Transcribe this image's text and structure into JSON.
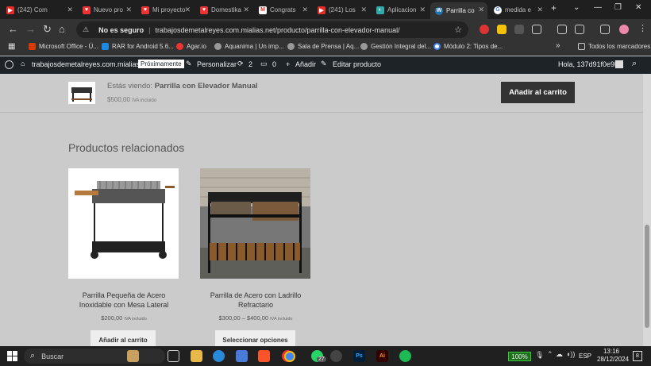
{
  "tabs": [
    {
      "label": "(242) Com",
      "color": "#e52d27",
      "glyph": "▶"
    },
    {
      "label": "Nuevo pro",
      "color": "#e33",
      "glyph": "♥"
    },
    {
      "label": "Mi proyecto",
      "color": "#e33",
      "glyph": "♥"
    },
    {
      "label": "Domestika",
      "color": "#e33",
      "glyph": "♥"
    },
    {
      "label": "Congrats",
      "color": "#fff",
      "glyph": "M"
    },
    {
      "label": "(241) Los",
      "color": "#e52d27",
      "glyph": "▶"
    },
    {
      "label": "Aplicacion",
      "color": "#3aa",
      "glyph": "◐"
    },
    {
      "label": "Parrilla co",
      "color": "#2271b1",
      "glyph": "W"
    },
    {
      "label": "medida e",
      "color": "#fff",
      "glyph": "G"
    }
  ],
  "new_tab": "+",
  "window": {
    "minimize": "—",
    "restore": "❐",
    "close": "✕",
    "chevron": "⌄"
  },
  "nav": {
    "back": "←",
    "forward": "→",
    "reload": "↻",
    "home": "⌂"
  },
  "address": {
    "security": "No es seguro",
    "url": "trabajosdemetalreyes.com.mialias.net/producto/parrilla-con-elevador-manual/",
    "star": "☆"
  },
  "bookmarks": [
    {
      "label": "Microsoft Office - Ú...",
      "color": "#d83b01"
    },
    {
      "label": "RAR for Android 5.6...",
      "color": "#1e88e5"
    },
    {
      "label": "Agar.io",
      "color": "#e33"
    },
    {
      "label": "Aquanima | Un imp...",
      "color": "#999"
    },
    {
      "label": "Sala de Prensa | Aq...",
      "color": "#999"
    },
    {
      "label": "Gestión Integral del...",
      "color": "#999"
    },
    {
      "label": "Módulo 2: Tipos de...",
      "color": "#4285f4"
    }
  ],
  "bookmarks_more": "»",
  "bookmarks_all": "Todos los marcadores",
  "wpbar": {
    "site": "trabajosdemetalreyes.com.mialias.net",
    "badge": "Próximamente",
    "customize": "Personalizar",
    "updates": "2",
    "comments": "0",
    "new": "Añadir",
    "edit": "Editar producto",
    "greeting": "Hola, 137d91f0e9b5"
  },
  "sticky": {
    "viewing_prefix": "Estás viendo:",
    "product": "Parrilla con Elevador Manual",
    "price": "$500,00",
    "tax": "IVA incluido",
    "cta": "Añadir al carrito"
  },
  "related": {
    "heading": "Productos relacionados",
    "products": [
      {
        "name": "Parrilla Pequeña de Acero Inoxidable con Mesa Lateral",
        "price": "$200,00",
        "tax": "IVA incluido",
        "button": "Añadir al carrito"
      },
      {
        "name": "Parrilla de Acero con Ladrillo Refractario",
        "price": "$300,00 – $400,00",
        "tax": "IVA incluido",
        "button": "Seleccionar opciones"
      }
    ]
  },
  "taskbar": {
    "search": "Buscar",
    "battery": "100%",
    "lang": "ESP",
    "time": "13:16",
    "date": "28/12/2024",
    "whatsapp_badge": "27",
    "notif": "8"
  }
}
